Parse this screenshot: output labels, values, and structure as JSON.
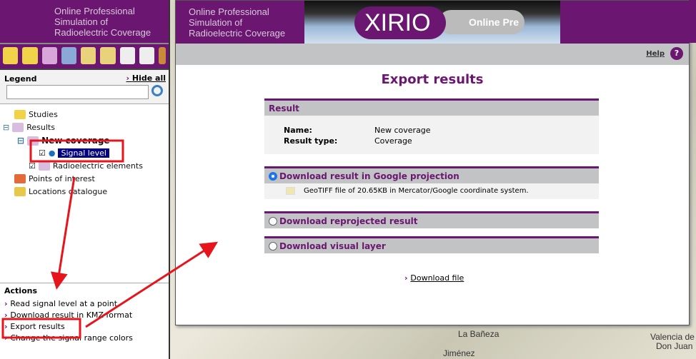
{
  "app": {
    "tagline": [
      "Online Professional",
      "Simulation of",
      "Radioelectric Coverage"
    ],
    "logo_text": "XIRIO",
    "logo_sub": "Online Pre",
    "accent": "#6b1670"
  },
  "legend": {
    "title": "Legend",
    "hide_all": "Hide all",
    "search_placeholder": ""
  },
  "tree": {
    "studies": "Studies",
    "results": "Results",
    "new_coverage": "New coverage",
    "signal_level": "Signal level",
    "radio_elements": "Radioelectric elements",
    "poi": "Points of interest",
    "locations": "Locations catalogue"
  },
  "actions": {
    "title": "Actions",
    "items": [
      "Read signal level at a point",
      "Download result in KMZ format",
      "Export results",
      "Change the signal range colors"
    ]
  },
  "map": {
    "labels": [
      "La Bañeza",
      "Jiménez",
      "Valencia de",
      "Don Juan"
    ]
  },
  "modal": {
    "help": "Help",
    "title": "Export results",
    "result": {
      "header": "Result",
      "name_label": "Name:",
      "name_value": "New coverage",
      "type_label": "Result type:",
      "type_value": "Coverage"
    },
    "options": [
      {
        "label": "Download result in Google projection",
        "selected": true,
        "detail": "GeoTIFF file of 20.65KB in Mercator/Google coordinate system."
      },
      {
        "label": "Download reprojected result",
        "selected": false
      },
      {
        "label": "Download visual layer",
        "selected": false
      }
    ],
    "download": "Download file"
  }
}
